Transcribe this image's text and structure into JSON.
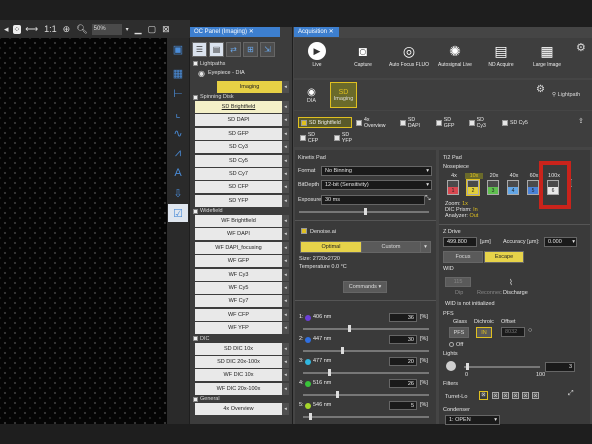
{
  "viewer": {
    "zoom_ratio": "1:1",
    "zoom_value": "50%"
  },
  "oc_panel": {
    "tab_title": "OC Panel (Imaging)",
    "groups": {
      "lightpaths": "Lightpaths",
      "spinning_disk": "Spinning Disk",
      "widefield": "Widefield",
      "dic": "DIC",
      "general": "General"
    },
    "eyepiece_label": "Eyepiece - DIA",
    "imaging_label": "Imaging",
    "spinning_items": [
      "SD Brightfield",
      "SD DAPI",
      "SD GFP",
      "SD Cy3",
      "SD Cy5",
      "SD Cy7",
      "SD CFP",
      "SD YFP"
    ],
    "widefield_items": [
      "WF Brightfield",
      "WF DAPI",
      "WF DAPI_focusing",
      "WF GFP",
      "WF Cy3",
      "WF Cy5",
      "WF Cy7",
      "WF CFP",
      "WF YFP"
    ],
    "dic_items": [
      "SD DIC 10x",
      "SD DIC 20x-100x",
      "WF DIC 10x",
      "WF DIC 20x-100x"
    ],
    "general_items": [
      "4x Overview"
    ]
  },
  "acquisition": {
    "tab_title": "Acquisition",
    "tools": [
      {
        "label": "Live",
        "icon": "play-icon"
      },
      {
        "label": "Capture",
        "icon": "camera-icon"
      },
      {
        "label": "Auto Focus FLUO",
        "icon": "autofocus-icon"
      },
      {
        "label": "Autosignal Live",
        "icon": "autosignal-icon"
      },
      {
        "label": "ND Acquire",
        "icon": "nd-acquire-icon"
      },
      {
        "label": "Large Image",
        "icon": "large-image-icon"
      }
    ],
    "modes": [
      {
        "label": "DIA",
        "icon": "eye-icon"
      },
      {
        "label": "Imaging",
        "icon": "sd-icon"
      }
    ],
    "lightpath_label": "Lightpath",
    "optical_configs": [
      "SD Brightfield",
      "4x Overview",
      "SD DAPI",
      "SD GFP",
      "SD Cy3",
      "SD Cy5",
      "SD CFP",
      "SD YFP"
    ]
  },
  "kinetix": {
    "title": "Kinetix Pad",
    "format_label": "Format",
    "format_value": "No Binning",
    "bitdepth_label": "BitDepth",
    "bitdepth_value": "12-bit (Sensitivity)",
    "exposure_label": "Exposure",
    "exposure_value": "30 ms",
    "exposure_level": 0.5,
    "denoise_label": "Denoise.ai",
    "optimal_label": "Optimal",
    "custom_label": "Custom",
    "size_text": "Size: 2720x2720",
    "temperature_text": "Temperature 0.0 °C",
    "commands_label": "Commands",
    "lasers": [
      {
        "index": "1:",
        "wavelength": "406 nm",
        "power": "36",
        "unit": "[%]",
        "color": "#6b3fd8",
        "level": 0.36
      },
      {
        "index": "2:",
        "wavelength": "447 nm",
        "power": "30",
        "unit": "[%]",
        "color": "#2f6fe0",
        "level": 0.3
      },
      {
        "index": "3:",
        "wavelength": "477 nm",
        "power": "20",
        "unit": "[%]",
        "color": "#31b7e0",
        "level": 0.2
      },
      {
        "index": "4:",
        "wavelength": "516 nm",
        "power": "26",
        "unit": "[%]",
        "color": "#3ac43a",
        "level": 0.26
      },
      {
        "index": "5:",
        "wavelength": "546 nm",
        "power": "5",
        "unit": "[%]",
        "color": "#a6d62a",
        "level": 0.05
      }
    ]
  },
  "ti2": {
    "title": "Ti2 Pad",
    "nosepiece_label": "Nosepiece",
    "objectives": [
      {
        "mag": "4x",
        "num": "1",
        "color": "#d8474f"
      },
      {
        "mag": "10x",
        "num": "2",
        "color": "#e2cf3a"
      },
      {
        "mag": "20x",
        "num": "3",
        "color": "#5fbf4f"
      },
      {
        "mag": "40x",
        "num": "4",
        "color": "#63a6e6"
      },
      {
        "mag": "60x",
        "num": "5",
        "color": "#4a82d6"
      },
      {
        "mag": "100x",
        "num": "6",
        "color": "#e8e8e8"
      }
    ],
    "selected_objective": "10x",
    "zoom_text": "Zoom:",
    "zoom_value": "1x",
    "dic_prism_text": "DIC Prism:",
    "dic_prism_value": "In",
    "analyzer_text": "Analyzer:",
    "analyzer_value": "Out",
    "zdrive_label": "Z Drive",
    "z_value": "499.800",
    "z_unit": "[µm]",
    "accuracy_label": "Accuracy [µm]:",
    "accuracy_value": "0.000",
    "focus_label": "Focus",
    "escape_label": "Escape",
    "wid_label": "WID",
    "wid_step_value": "115",
    "wid_buttons": [
      "Dip",
      "Reconnec",
      "Discharge"
    ],
    "wid_status": "WID is not initialized",
    "pfs_label": "PFS",
    "pfs_cols": [
      "Glass",
      "Dichroic",
      "Offset"
    ],
    "pfs_button": "PFS",
    "dichroic_value": "IN",
    "offset_value": "8032",
    "pfs_off": "Off",
    "lights_label": "Lights",
    "lights_min": "0",
    "lights_max": "100",
    "lights_value": "3",
    "filters_label": "Filters",
    "turret_label": "Turret-Lo",
    "condenser_label": "Condenser",
    "condenser_value": "1: OPEN"
  }
}
